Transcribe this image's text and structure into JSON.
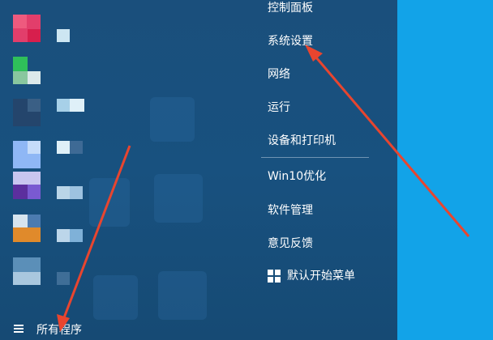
{
  "menu": {
    "items": [
      {
        "label": "控制面板"
      },
      {
        "label": "系统设置"
      },
      {
        "label": "网络"
      },
      {
        "label": "运行"
      },
      {
        "label": "设备和打印机"
      },
      {
        "label": "Win10优化"
      },
      {
        "label": "软件管理"
      },
      {
        "label": "意见反馈"
      },
      {
        "label": "默认开始菜单"
      }
    ]
  },
  "footer": {
    "all_programs": "所有程序"
  },
  "colors": {
    "menu_bg": "#18517f",
    "desktop_bg": "#12a3e8",
    "arrow": "#e8452f",
    "text": "#ffffff"
  },
  "icons": [
    "windows-logo-icon",
    "list-icon"
  ]
}
